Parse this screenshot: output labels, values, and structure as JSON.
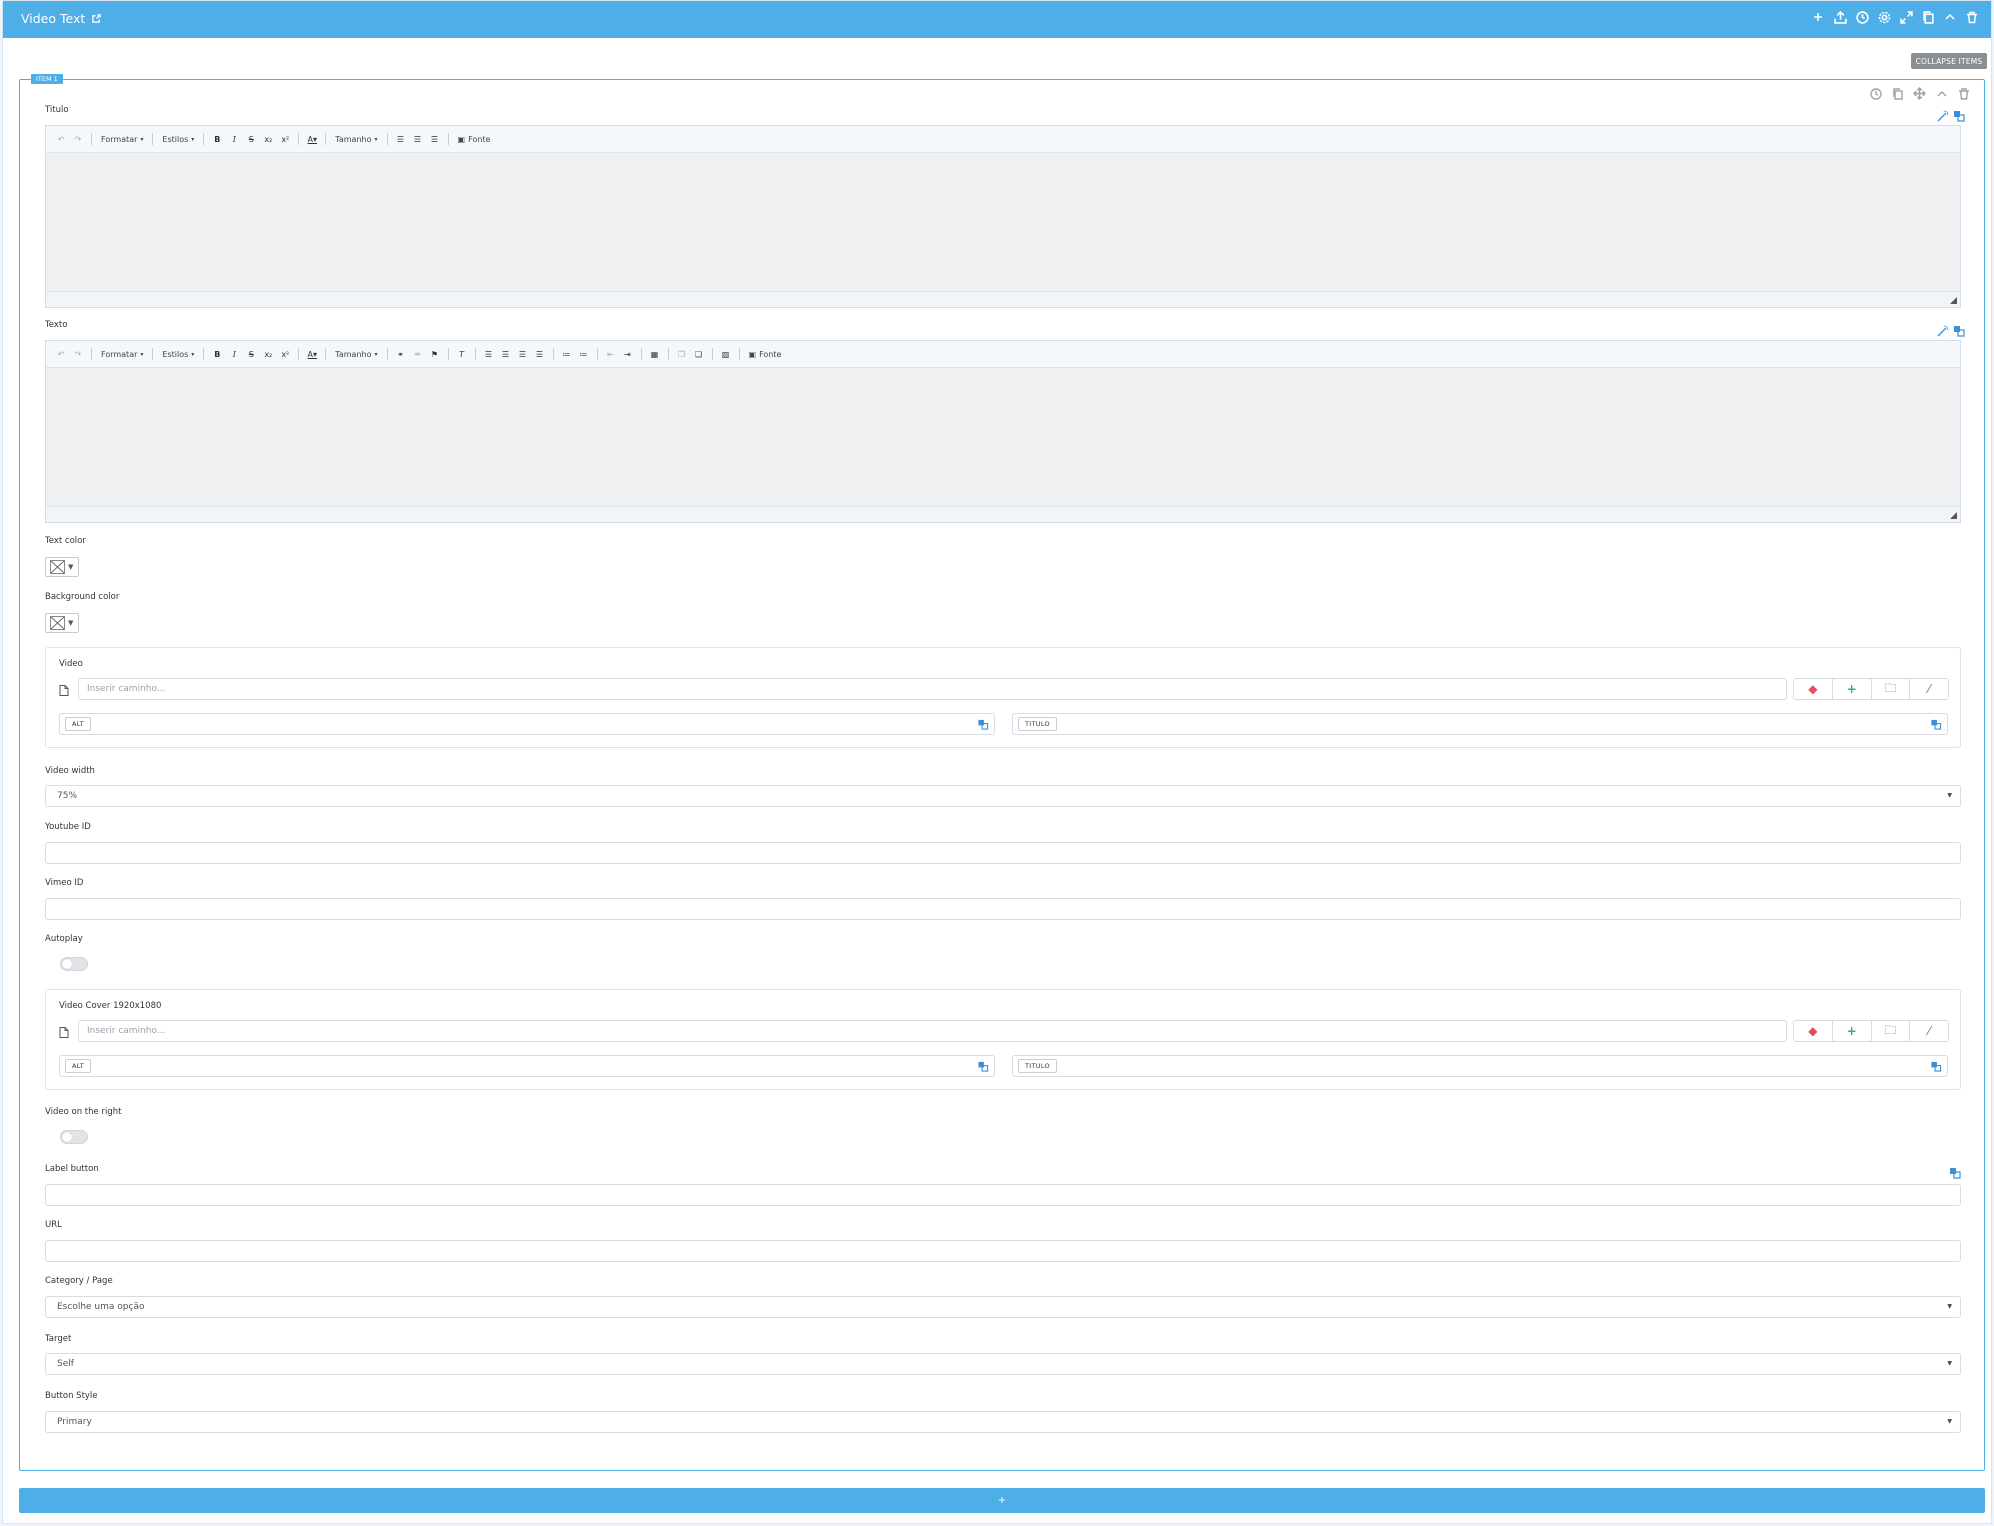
{
  "window": {
    "title": "Video Text"
  },
  "toolbar": {
    "collapse_label": "COLLAPSE ITEMS",
    "item_tag": "ITEM 1"
  },
  "fields": {
    "titulo": {
      "label": "Titulo"
    },
    "texto": {
      "label": "Texto"
    },
    "text_color": {
      "label": "Text color"
    },
    "background_color": {
      "label": "Background color"
    },
    "video": {
      "title": "Video",
      "placeholder": "Inserir caminho...",
      "alt_label": "ALT",
      "titulo_label": "TITULO"
    },
    "video_width": {
      "label": "Video width",
      "value": "75%"
    },
    "youtube_id": {
      "label": "Youtube ID",
      "value": ""
    },
    "vimeo_id": {
      "label": "Vimeo ID",
      "value": ""
    },
    "autoplay": {
      "label": "Autoplay",
      "on": false
    },
    "video_cover": {
      "title": "Video Cover 1920x1080",
      "placeholder": "Inserir caminho...",
      "alt_label": "ALT",
      "titulo_label": "TITULO"
    },
    "video_on_right": {
      "label": "Video on the right",
      "on": false
    },
    "label_button": {
      "label": "Label button",
      "value": ""
    },
    "url": {
      "label": "URL",
      "value": ""
    },
    "category_page": {
      "label": "Category / Page",
      "value": "Escolhe uma opção"
    },
    "target": {
      "label": "Target",
      "value": "Self"
    },
    "button_style": {
      "label": "Button Style",
      "value": "Primary"
    }
  },
  "editor_toolbar": {
    "format": "Formatar",
    "styles": "Estilos",
    "size": "Tamanho",
    "source": "Fonte"
  },
  "add_label": "+",
  "colors": {
    "accent": "#4daee8",
    "danger": "#e74c5b",
    "success": "#2bb673"
  }
}
